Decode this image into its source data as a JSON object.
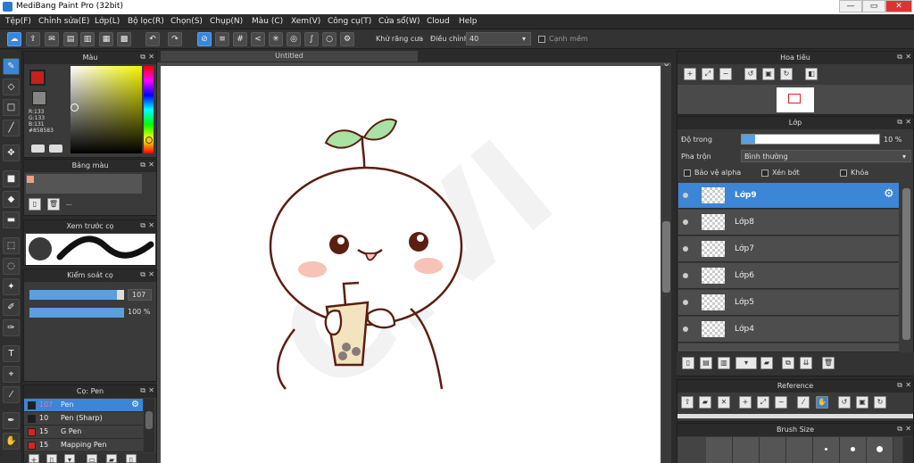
{
  "app": {
    "title": "MediBang Paint Pro (32bit)"
  },
  "window_controls": {
    "minimize": "—",
    "maximize": "▭",
    "close": "✕"
  },
  "menu": [
    "Tệp(F)",
    "Chỉnh sửa(E)",
    "Lớp(L)",
    "Bộ lọc(R)",
    "Chọn(S)",
    "Chụp(N)",
    "Màu (C)",
    "Xem(V)",
    "Công cụ(T)",
    "Cửa sổ(W)",
    "Cloud",
    "Help"
  ],
  "toolbar": {
    "antialias_label": "Khử răng cưa",
    "antialias_checked": true,
    "adjust_label": "Điều chỉnh",
    "adjust_value": "40",
    "smooth_label": "Cạnh mềm"
  },
  "canvas": {
    "tab_title": "Untitled"
  },
  "color_panel": {
    "title": "Màu",
    "r": "R:133",
    "g": "G:133",
    "b": "B:131",
    "hex": "#858583",
    "primary_color": "#c81e1e",
    "secondary_color": "#858583"
  },
  "palette_panel": {
    "title": "Bảng màu",
    "swatch": "#f0a080",
    "ellipsis": "---"
  },
  "brush_preview": {
    "title": "Xem trước cọ"
  },
  "brush_control": {
    "title": "Kiểm soát cọ",
    "size_value": "107",
    "size_fraction": 0.92,
    "opacity_value": "100 %",
    "opacity_fraction": 1.0
  },
  "brush_panel": {
    "title": "Cọ: Pen",
    "items": [
      {
        "size": "107",
        "name": "Pen",
        "color": "#1e1e1e",
        "selected": true
      },
      {
        "size": "10",
        "name": "Pen (Sharp)",
        "color": "#1e1e1e",
        "selected": false
      },
      {
        "size": "15",
        "name": "G Pen",
        "color": "#e02020",
        "selected": false
      },
      {
        "size": "15",
        "name": "Mapping Pen",
        "color": "#e02020",
        "selected": false
      }
    ]
  },
  "navigator": {
    "title": "Hoa tiêu"
  },
  "layer_panel": {
    "title": "Lớp",
    "opacity_label": "Độ trong",
    "opacity_value": "10 %",
    "opacity_fraction": 0.1,
    "blend_label": "Pha trộn",
    "blend_value": "Bình thường",
    "protect_alpha": "Bảo vệ alpha",
    "clipping": "Xén bớt",
    "lock": "Khóa",
    "layers": [
      {
        "name": "Lớp9",
        "selected": true
      },
      {
        "name": "Lớp8",
        "selected": false
      },
      {
        "name": "Lớp7",
        "selected": false
      },
      {
        "name": "Lớp6",
        "selected": false
      },
      {
        "name": "Lớp5",
        "selected": false
      },
      {
        "name": "Lớp4",
        "selected": false
      }
    ]
  },
  "reference_panel": {
    "title": "Reference"
  },
  "brush_size_panel": {
    "title": "Brush Size"
  }
}
